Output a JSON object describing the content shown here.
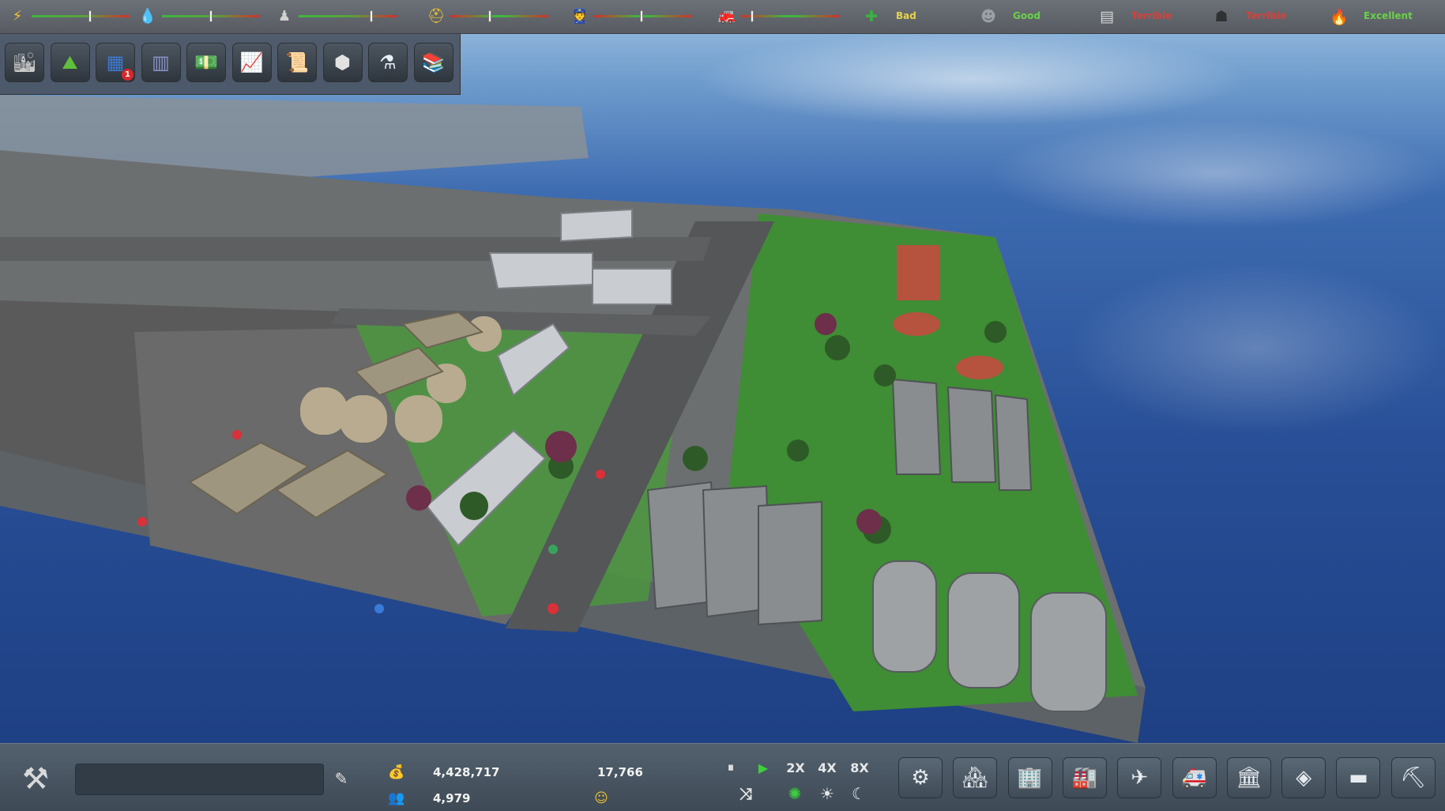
{
  "top_bar": {
    "resources": [
      {
        "icon": "lightning-icon",
        "glyph": "⚡",
        "color": "#f4c430",
        "level": 0.6
      },
      {
        "icon": "water-drop-icon",
        "glyph": "💧",
        "color": "#3e92e8",
        "level": 0.5
      },
      {
        "icon": "waste-bag-icon",
        "glyph": "♟",
        "color": "#d0d0d0",
        "level": 0.75
      },
      {
        "icon": "worker-icon",
        "glyph": "⛑",
        "color": "#f0c330",
        "level": 0.4
      },
      {
        "icon": "police-icon",
        "glyph": "👮",
        "color": "#d9d9d9",
        "level": 0.48
      },
      {
        "icon": "fire-department-icon",
        "glyph": "🚒",
        "color": "#d9d9d9",
        "level": 0.1
      }
    ],
    "status": [
      {
        "icon": "health-cross-icon",
        "glyph": "✚",
        "color": "#3cb043",
        "label": "Bad",
        "label_color": "#e8d24a"
      },
      {
        "icon": "education-icon",
        "glyph": "☻",
        "color": "#9aa0a6",
        "label": "Good",
        "label_color": "#6ad14a"
      },
      {
        "icon": "map-icon",
        "glyph": "▤",
        "color": "#d8d8d8",
        "label": "Terrible",
        "label_color": "#d6413b"
      },
      {
        "icon": "crime-mask-icon",
        "glyph": "☗",
        "color": "#2f3133",
        "label": "Terrible",
        "label_color": "#d6413b"
      },
      {
        "icon": "fire-risk-icon",
        "glyph": "🔥",
        "color": "#e14a3a",
        "label": "Excellent",
        "label_color": "#6ad14a"
      }
    ]
  },
  "tools": [
    {
      "icon": "city-overview-icon",
      "glyph": "🏙",
      "color": "#c9c9c9"
    },
    {
      "icon": "terrain-icon",
      "glyph": "⛰",
      "color": "#5fbf3b"
    },
    {
      "icon": "zoning-icon",
      "glyph": "▦",
      "color": "#3d7bd1",
      "badge": "1"
    },
    {
      "icon": "roads-icon",
      "glyph": "▥",
      "color": "#8a95c9"
    },
    {
      "icon": "finances-icon",
      "glyph": "💵",
      "color": "#8fa36a"
    },
    {
      "icon": "statistics-icon",
      "glyph": "📈",
      "color": "#c7a872"
    },
    {
      "icon": "policies-icon",
      "glyph": "📜",
      "color": "#e8e0d0"
    },
    {
      "icon": "districts-icon",
      "glyph": "⬢",
      "color": "#e2e2e2"
    },
    {
      "icon": "research-icon",
      "glyph": "⚗",
      "color": "#e8eef5"
    },
    {
      "icon": "library-icon",
      "glyph": "📚",
      "color": "#6f9a4a"
    }
  ],
  "bottom_bar": {
    "build_icon": "build-tools-icon",
    "name_input": {
      "value": "",
      "placeholder": ""
    },
    "money": "4,428,717",
    "population": "4,979",
    "date_counter": "17,766",
    "happiness_icon": "smiley-icon",
    "speed": {
      "pause": "⏸",
      "play": "▶",
      "x2": "2X",
      "x4": "4X",
      "x8": "8X"
    },
    "buildings": [
      {
        "icon": "power-plant-icon",
        "glyph": "⚙"
      },
      {
        "icon": "residential-icon",
        "glyph": "🏘"
      },
      {
        "icon": "commercial-icon",
        "glyph": "🏢"
      },
      {
        "icon": "industrial-icon",
        "glyph": "🏭"
      },
      {
        "icon": "transport-icon",
        "glyph": "✈"
      },
      {
        "icon": "services-icon",
        "glyph": "🚑"
      },
      {
        "icon": "government-icon",
        "glyph": "🏛"
      },
      {
        "icon": "landmarks-icon",
        "glyph": "◈"
      },
      {
        "icon": "parks-icon",
        "glyph": "▬"
      },
      {
        "icon": "demolish-icon",
        "glyph": "⛏"
      }
    ]
  }
}
